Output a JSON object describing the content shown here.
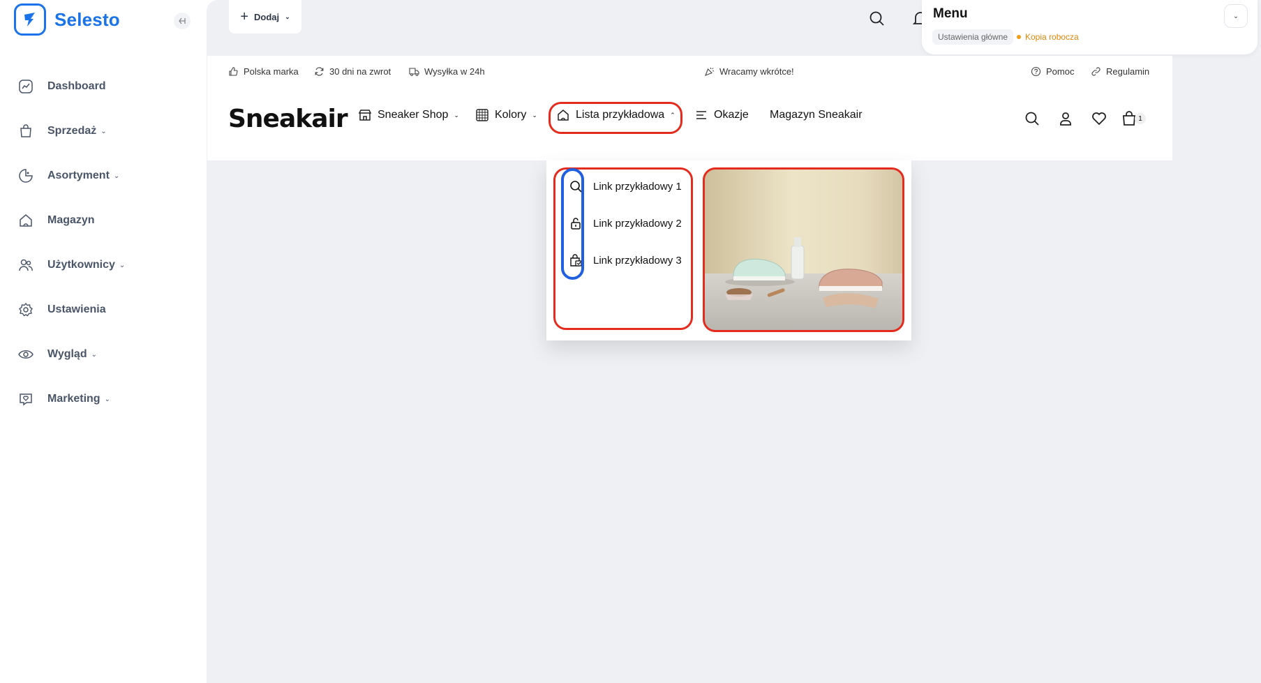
{
  "brand": {
    "name": "Selesto",
    "color": "#1a73e8"
  },
  "sidebar": {
    "items": [
      {
        "label": "Dashboard",
        "icon": "chart-icon",
        "has_dropdown": false
      },
      {
        "label": "Sprzedaż",
        "icon": "bag-icon",
        "has_dropdown": true
      },
      {
        "label": "Asortyment",
        "icon": "tag-icon",
        "has_dropdown": true
      },
      {
        "label": "Magazyn",
        "icon": "home-icon",
        "has_dropdown": false
      },
      {
        "label": "Użytkownicy",
        "icon": "users-icon",
        "has_dropdown": true
      },
      {
        "label": "Ustawienia",
        "icon": "gear-icon",
        "has_dropdown": false
      },
      {
        "label": "Wygląd",
        "icon": "eye-icon",
        "has_dropdown": true
      },
      {
        "label": "Marketing",
        "icon": "heart-chat-icon",
        "has_dropdown": true
      }
    ]
  },
  "header": {
    "add_label": "Dodaj"
  },
  "menu_panel": {
    "title": "Menu",
    "chip": "Ustawienia główne",
    "status": "Kopia robocza",
    "status_color": "#f29d12"
  },
  "shop": {
    "topbar": {
      "left": [
        "Polska marka",
        "30 dni na zwrot",
        "Wysyłka w 24h"
      ],
      "center": "Wracamy wkrótce!",
      "right": [
        "Pomoc",
        "Regulamin"
      ]
    },
    "logo": "Sneakair",
    "nav": [
      {
        "label": "Sneaker Shop",
        "icon": "store-icon",
        "chevron": "down"
      },
      {
        "label": "Kolory",
        "icon": "grid-icon",
        "chevron": "down"
      },
      {
        "label": "Lista przykładowa",
        "icon": "home-icon",
        "chevron": "up"
      },
      {
        "label": "Okazje",
        "icon": "lines-icon",
        "chevron": ""
      },
      {
        "label": "Magazyn Sneakair",
        "icon": "",
        "chevron": ""
      }
    ],
    "cart_count": "1"
  },
  "dropdown": {
    "links": [
      {
        "label": "Link przykładowy 1",
        "icon": "search-icon"
      },
      {
        "label": "Link przykładowy 2",
        "icon": "lock-icon"
      },
      {
        "label": "Link przykładowy 3",
        "icon": "shopping-bag-icon"
      }
    ],
    "image": "sneakers-photo"
  },
  "annotations": {
    "red": "#e52b1e",
    "blue": "#1f5fe0"
  }
}
